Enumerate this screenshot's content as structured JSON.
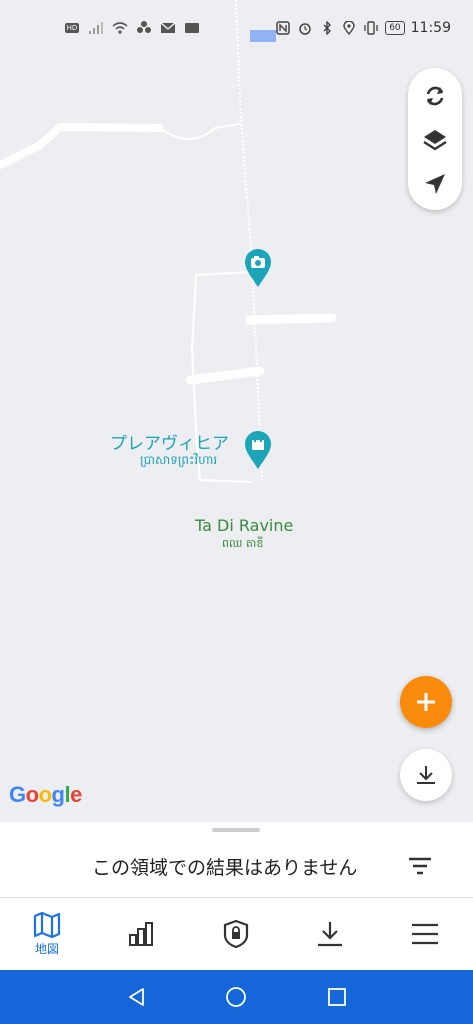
{
  "status_bar": {
    "time": "11:59",
    "battery": "60",
    "icons": [
      "hd-icon",
      "signal-icon",
      "wifi-icon",
      "fan-icon",
      "mail-icon",
      "sms-icon",
      "nfc-icon",
      "alarm-icon",
      "bluetooth-icon",
      "location-icon",
      "vibrate-icon",
      "battery-icon"
    ],
    "hd_label": "HD"
  },
  "map": {
    "controls": [
      "refresh-icon",
      "layers-icon",
      "navigate-icon"
    ],
    "poi_temple": {
      "name": "プレアヴィヒア",
      "khmer": "ប្រាសាទព្រះវិហារ",
      "icon": "castle-icon"
    },
    "poi_photo": {
      "icon": "camera-icon"
    },
    "place": {
      "name": "Ta Di Ravine",
      "khmer": "ពឈ តាឌី"
    },
    "attribution": "Google"
  },
  "sheet": {
    "message": "この領域での結果はありません"
  },
  "bottom_nav": {
    "items": [
      {
        "icon": "map-icon",
        "label": "地図",
        "active": true
      },
      {
        "icon": "stats-icon",
        "label": ""
      },
      {
        "icon": "lock-icon",
        "label": ""
      },
      {
        "icon": "download-icon",
        "label": ""
      },
      {
        "icon": "menu-icon",
        "label": ""
      }
    ]
  },
  "colors": {
    "accent": "#1a73e8",
    "fab": "#f98a0c",
    "poi": "#1ca4b9",
    "place": "#3b8a3d",
    "android_nav": "#1466d9"
  }
}
